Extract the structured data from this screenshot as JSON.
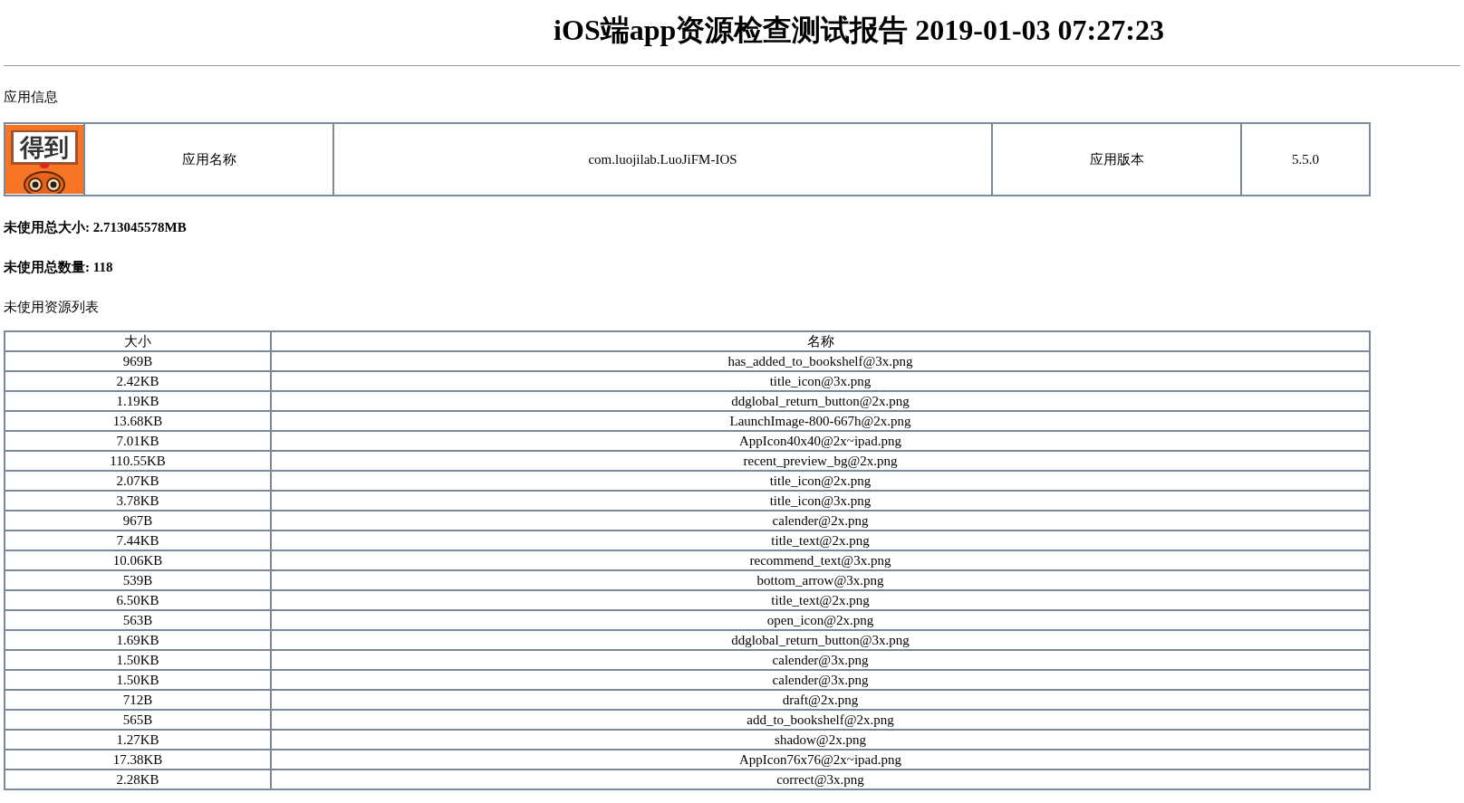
{
  "title": "iOS端app资源检查测试报告 2019-01-03 07:27:23",
  "app_info": {
    "heading": "应用信息",
    "logo_text": "得到",
    "name_label": "应用名称",
    "name_value": "com.luojilab.LuoJiFM-IOS",
    "version_label": "应用版本",
    "version_value": "5.5.0"
  },
  "summary": [
    {
      "label": "未使用总大小:",
      "value": "2.713045578MB"
    },
    {
      "label": "未使用总数量:",
      "value": "118"
    }
  ],
  "list_heading": "未使用资源列表",
  "table": {
    "columns": [
      "大小",
      "名称"
    ],
    "rows": [
      [
        "969B",
        "has_added_to_bookshelf@3x.png"
      ],
      [
        "2.42KB",
        "title_icon@3x.png"
      ],
      [
        "1.19KB",
        "ddglobal_return_button@2x.png"
      ],
      [
        "13.68KB",
        "LaunchImage-800-667h@2x.png"
      ],
      [
        "7.01KB",
        "AppIcon40x40@2x~ipad.png"
      ],
      [
        "110.55KB",
        "recent_preview_bg@2x.png"
      ],
      [
        "2.07KB",
        "title_icon@2x.png"
      ],
      [
        "3.78KB",
        "title_icon@3x.png"
      ],
      [
        "967B",
        "calender@2x.png"
      ],
      [
        "7.44KB",
        "title_text@2x.png"
      ],
      [
        "10.06KB",
        "recommend_text@3x.png"
      ],
      [
        "539B",
        "bottom_arrow@3x.png"
      ],
      [
        "6.50KB",
        "title_text@2x.png"
      ],
      [
        "563B",
        "open_icon@2x.png"
      ],
      [
        "1.69KB",
        "ddglobal_return_button@3x.png"
      ],
      [
        "1.50KB",
        "calender@3x.png"
      ],
      [
        "1.50KB",
        "calender@3x.png"
      ],
      [
        "712B",
        "draft@2x.png"
      ],
      [
        "565B",
        "add_to_bookshelf@2x.png"
      ],
      [
        "1.27KB",
        "shadow@2x.png"
      ],
      [
        "17.38KB",
        "AppIcon76x76@2x~ipad.png"
      ],
      [
        "2.28KB",
        "correct@3x.png"
      ]
    ]
  }
}
